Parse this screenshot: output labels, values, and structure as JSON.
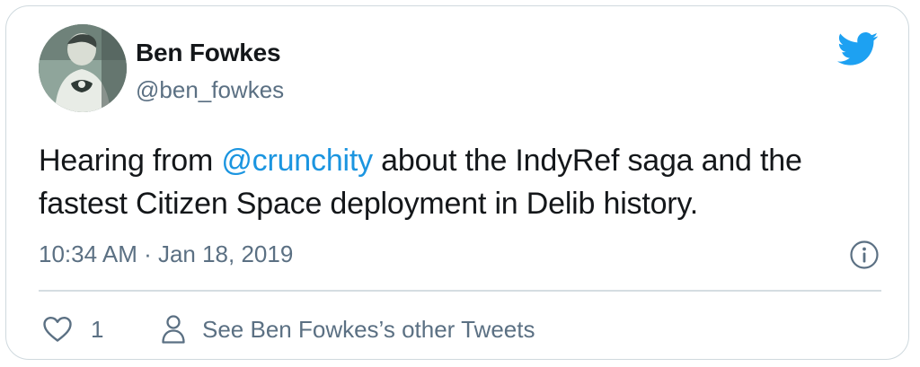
{
  "tweet": {
    "author_name": "Ben Fowkes",
    "author_handle": "@ben_fowkes",
    "text_before": "Hearing from ",
    "mention": "@crunchity",
    "text_after": " about the IndyRef saga and the fastest Citizen Space deployment in Delib history.",
    "timestamp": "10:34 AM · Jan 18, 2019"
  },
  "actions": {
    "like_count": "1",
    "other_tweets_label": "See Ben Fowkes’s other Tweets"
  },
  "icons": {
    "brand": "twitter-bird-icon",
    "info": "info-icon",
    "like": "heart-icon",
    "profile": "person-icon"
  },
  "colors": {
    "brand_blue": "#1da1f2",
    "link_blue": "#1b95e0",
    "secondary_text": "#5b7083",
    "primary_text": "#14171a",
    "border": "#cfd9de"
  }
}
